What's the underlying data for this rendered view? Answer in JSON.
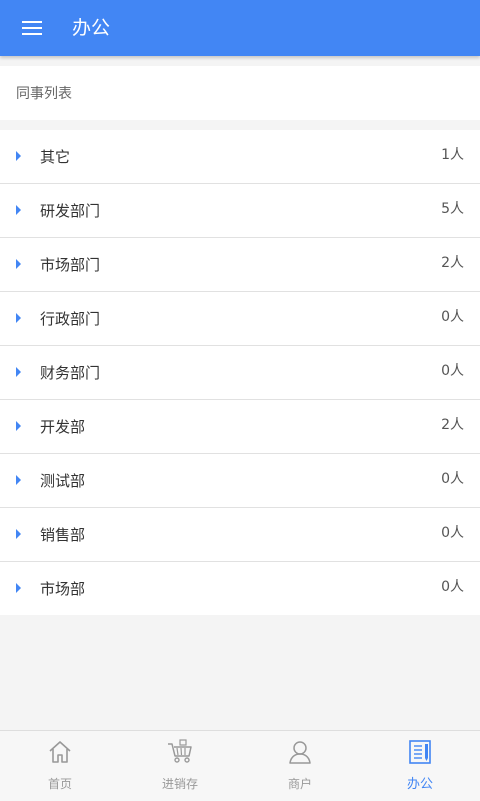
{
  "appbar": {
    "title": "办公",
    "menu_icon": "menu-icon"
  },
  "section": {
    "title": "同事列表"
  },
  "departments": [
    {
      "name": "其它",
      "count": "1人"
    },
    {
      "name": "研发部门",
      "count": "5人"
    },
    {
      "name": "市场部门",
      "count": "2人"
    },
    {
      "name": "行政部门",
      "count": "0人"
    },
    {
      "name": "财务部门",
      "count": "0人"
    },
    {
      "name": "开发部",
      "count": "2人"
    },
    {
      "name": "测试部",
      "count": "0人"
    },
    {
      "name": "销售部",
      "count": "0人"
    },
    {
      "name": "市场部",
      "count": "0人"
    }
  ],
  "tabs": [
    {
      "label": "首页",
      "icon": "home-icon"
    },
    {
      "label": "进销存",
      "icon": "cart-icon"
    },
    {
      "label": "商户",
      "icon": "user-icon"
    },
    {
      "label": "办公",
      "icon": "document-icon",
      "active": true
    }
  ],
  "colors": {
    "primary": "#4286f4",
    "inactive": "#999999",
    "background": "#f4f4f4"
  }
}
